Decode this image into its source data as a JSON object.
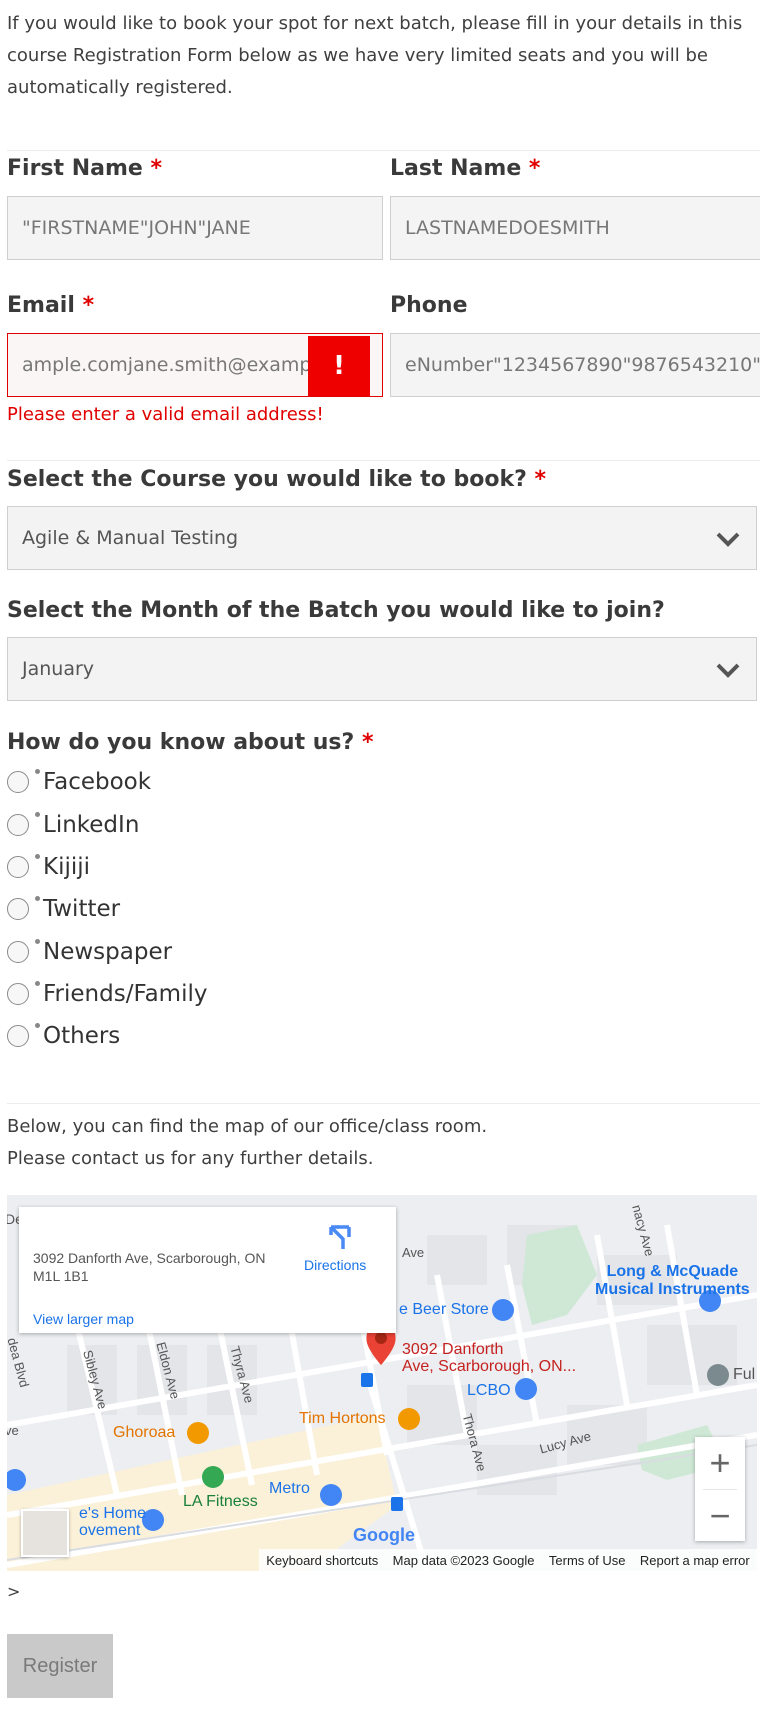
{
  "intro": {
    "text": "If you would like to book your spot for next batch, please fill in your details in this course Registration Form below as we have very limited seats and you will be automatically registered."
  },
  "form": {
    "first_name": {
      "label": "First Name",
      "required_mark": "*",
      "value": "\"FIRSTNAME\"JOHN\"JANE"
    },
    "last_name": {
      "label": "Last Name",
      "required_mark": "*",
      "value": "LASTNAMEDOESMITH"
    },
    "email": {
      "label": "Email",
      "required_mark": "*",
      "value": "ample.comjane.smith@exampl",
      "error_badge": "!",
      "error_message": "Please enter a valid email address!"
    },
    "phone": {
      "label": "Phone",
      "value": "eNumber\"1234567890\"9876543210\""
    },
    "course": {
      "label": "Select the Course you would like to book?",
      "required_mark": "*",
      "selected": "Agile & Manual Testing"
    },
    "month": {
      "label": "Select the Month of the Batch you would like to join?",
      "selected": "January"
    },
    "source": {
      "label": "How do you know about us?",
      "required_mark": "*",
      "options": [
        "Facebook",
        "LinkedIn",
        "Kijiji",
        "Twitter",
        "Newspaper",
        "Friends/Family",
        "Others"
      ]
    }
  },
  "map_note": {
    "line1": "Below, you can find the map of our office/class room.",
    "line2": "Please contact us for any further details."
  },
  "map": {
    "info_address": "3092 Danforth Ave, Scarborough, ON M1L 1B1",
    "directions": "Directions",
    "view_larger": "View larger map",
    "pin_label_line1": "3092 Danforth",
    "pin_label_line2": "Ave, Scarborough, ON...",
    "places": {
      "long_mcquade_1": "Long & McQuade",
      "long_mcquade_2": "Musical Instruments",
      "beer_store": "e Beer Store",
      "lcbo": "LCBO",
      "tim_hortons": "Tim Hortons",
      "ghoroaa": "Ghoroaa",
      "la_fitness": "LA Fitness",
      "metro": "Metro",
      "home_1": "e's Home",
      "home_2": "ovement",
      "ful": "Ful"
    },
    "streets": {
      "sibley": "Sibley Ave",
      "eldon": "Eldon Ave",
      "thyra": "Thyra Ave",
      "thora": "Thora Ave",
      "lucy": "Lucy Ave",
      "ave": "Ave",
      "nacy": "nacy Ave",
      "dea_blvd": "dea Blvd",
      "ve": "ve",
      "de": "De"
    },
    "google": "Google",
    "zoom_in": "+",
    "zoom_out": "−",
    "footer": {
      "shortcuts": "Keyboard shortcuts",
      "data": "Map data ©2023 Google",
      "terms": "Terms of Use",
      "report": "Report a map error"
    }
  },
  "stray_text": ">",
  "register_button": "Register"
}
